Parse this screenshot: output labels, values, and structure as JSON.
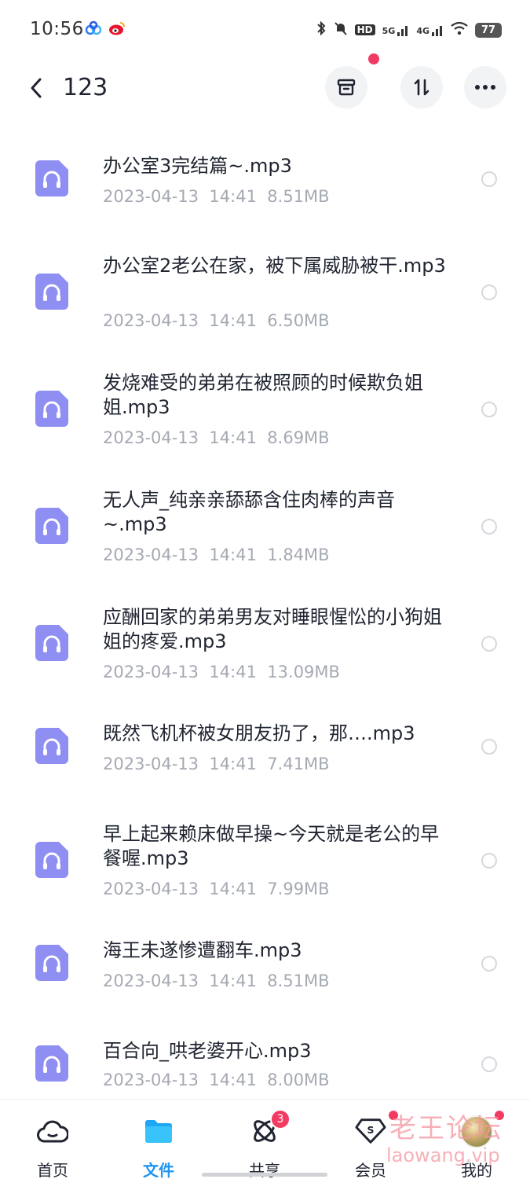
{
  "status_bar": {
    "time": "10:56",
    "battery": "77",
    "signal_labels": [
      "5G",
      "4G"
    ],
    "app_icons": [
      "baidu-netdisk-icon",
      "weibo-icon"
    ]
  },
  "header": {
    "title": "123",
    "buttons": [
      "archive-icon",
      "sort-icon",
      "more-icon"
    ]
  },
  "files": [
    {
      "name": "办公室3完结篇~.mp3",
      "date": "2023-04-13",
      "time": "14:41",
      "size": "8.51MB"
    },
    {
      "name": "办公室2老公在家，被下属威胁被干.mp3",
      "date": "2023-04-13",
      "time": "14:41",
      "size": "6.50MB"
    },
    {
      "name": "发烧难受的弟弟在被照顾的时候欺负姐姐.mp3",
      "date": "2023-04-13",
      "time": "14:41",
      "size": "8.69MB"
    },
    {
      "name": "无人声_纯亲亲舔舔含住肉棒的声音~.mp3",
      "date": "2023-04-13",
      "time": "14:41",
      "size": "1.84MB"
    },
    {
      "name": "应酬回家的弟弟男友对睡眼惺忪的小狗姐姐的疼爱.mp3",
      "date": "2023-04-13",
      "time": "14:41",
      "size": "13.09MB"
    },
    {
      "name": "既然飞机杯被女朋友扔了，那….mp3",
      "date": "2023-04-13",
      "time": "14:41",
      "size": "7.41MB"
    },
    {
      "name": "早上起来赖床做早操~今天就是老公的早餐喔.mp3",
      "date": "2023-04-13",
      "time": "14:41",
      "size": "7.99MB"
    },
    {
      "name": "海王未遂惨遭翻车.mp3",
      "date": "2023-04-13",
      "time": "14:41",
      "size": "8.51MB"
    },
    {
      "name": "百合向_哄老婆开心.mp3",
      "date": "2023-04-13",
      "time": "14:41",
      "size": "8.00MB"
    }
  ],
  "bottom_nav": {
    "items": [
      {
        "label": "首页",
        "icon": "cloud-icon",
        "active": false
      },
      {
        "label": "文件",
        "icon": "folder-icon",
        "active": true
      },
      {
        "label": "共享",
        "icon": "share-atom-icon",
        "active": false,
        "badge": "3"
      },
      {
        "label": "会员",
        "icon": "vip-diamond-icon",
        "active": false
      },
      {
        "label": "我的",
        "icon": "avatar",
        "active": false
      }
    ]
  },
  "watermark": {
    "line1": "老王论坛",
    "line2": "laowang.vip"
  },
  "colors": {
    "accent": "#1e95f2",
    "badge": "#f23b62",
    "file_icon": "#8f8ef2",
    "meta_text": "#a5a9b2"
  }
}
